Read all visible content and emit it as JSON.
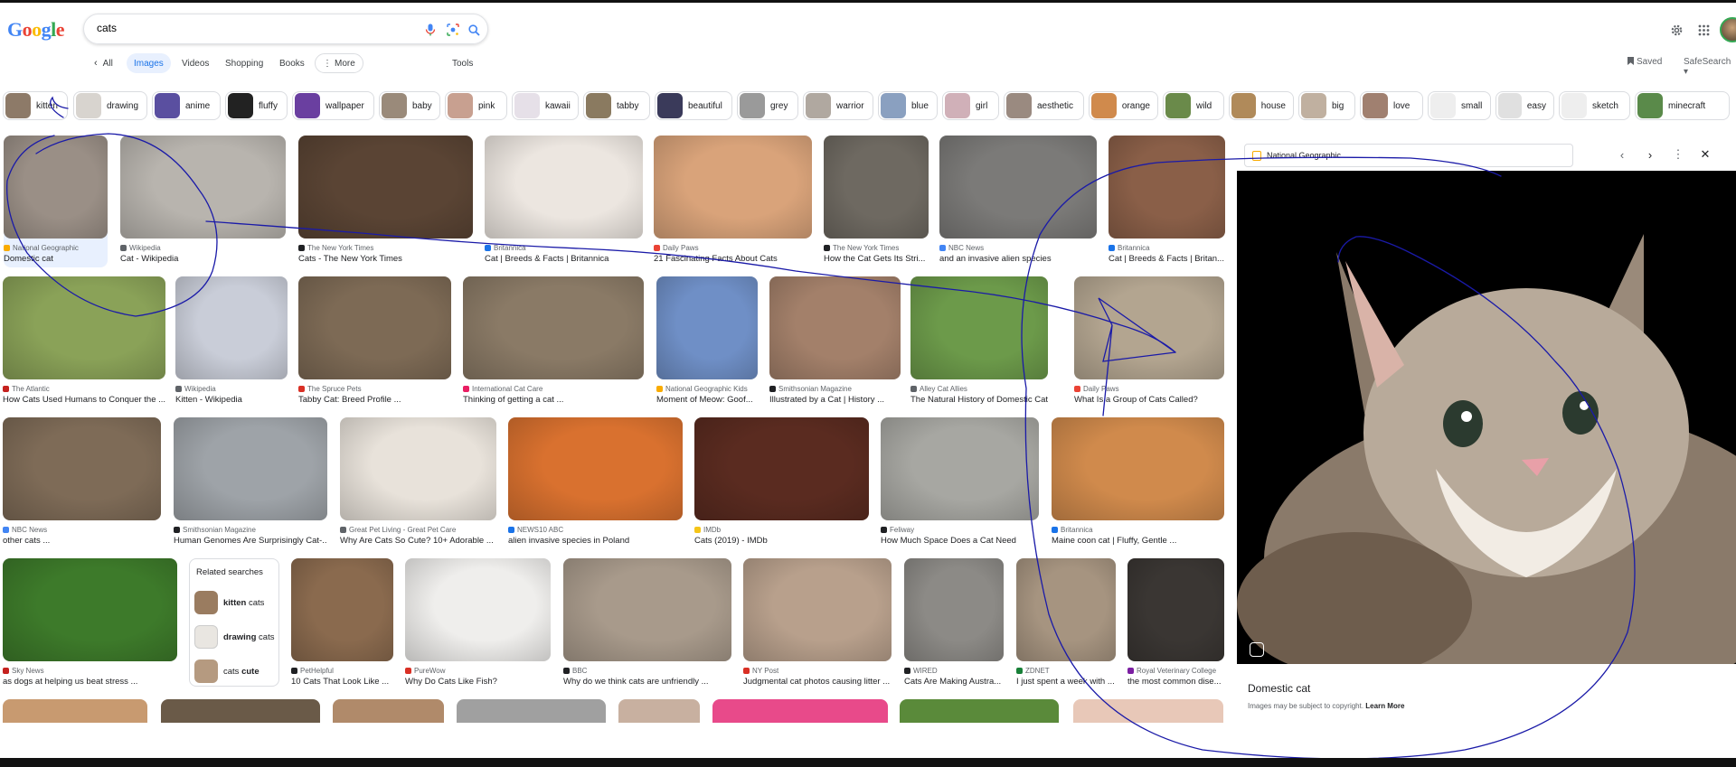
{
  "search": {
    "query": "cats"
  },
  "nav": {
    "all": "All",
    "images": "Images",
    "videos": "Videos",
    "shopping": "Shopping",
    "books": "Books",
    "more": "More",
    "tools": "Tools",
    "saved": "Saved",
    "safesearch": "SafeSearch"
  },
  "chips": [
    "kitten",
    "drawing",
    "anime",
    "fluffy",
    "wallpaper",
    "baby",
    "pink",
    "kawaii",
    "tabby",
    "beautiful",
    "grey",
    "warrior",
    "blue",
    "girl",
    "aesthetic",
    "orange",
    "wild",
    "house",
    "big",
    "love",
    "small",
    "easy",
    "sketch",
    "minecraft"
  ],
  "results": [
    {
      "source": "National Geographic",
      "title": "Domestic cat",
      "color": "#9a8f86",
      "fav": "#f9ab00"
    },
    {
      "source": "Wikipedia",
      "title": "Cat - Wikipedia",
      "color": "#b8b4ae",
      "fav": "#5f6368"
    },
    {
      "source": "The New York Times",
      "title": "Cats - The New York Times",
      "color": "#5a4434",
      "fav": "#202124"
    },
    {
      "source": "Britannica",
      "title": "Cat | Breeds & Facts | Britannica",
      "color": "#ece6e0",
      "fav": "#1a73e8"
    },
    {
      "source": "Daily Paws",
      "title": "21 Fascinating Facts About Cats",
      "color": "#d9a37a",
      "fav": "#ea4335"
    },
    {
      "source": "The New York Times",
      "title": "How the Cat Gets Its Stri...",
      "color": "#6e6961",
      "fav": "#202124"
    },
    {
      "source": "NBC News",
      "title": "and an invasive alien species",
      "color": "#7b7a78",
      "fav": "#4285f4"
    },
    {
      "source": "Britannica",
      "title": "Cat | Breeds & Facts | Britan...",
      "color": "#8a5f48",
      "fav": "#1a73e8"
    },
    {
      "source": "The Atlantic",
      "title": "How Cats Used Humans to Conquer the ...",
      "color": "#8aa258",
      "fav": "#c5221f"
    },
    {
      "source": "Wikipedia",
      "title": "Kitten - Wikipedia",
      "color": "#c9cdd8",
      "fav": "#5f6368"
    },
    {
      "source": "The Spruce Pets",
      "title": "Tabby Cat: Breed Profile ...",
      "color": "#7d6a55",
      "fav": "#d93025"
    },
    {
      "source": "International Cat Care",
      "title": "Thinking of getting a cat ...",
      "color": "#8a7a66",
      "fav": "#e91e63"
    },
    {
      "source": "National Geographic Kids",
      "title": "Moment of Meow: Goof...",
      "color": "#6f8fc6",
      "fav": "#f9ab00"
    },
    {
      "source": "Smithsonian Magazine",
      "title": "Illustrated by a Cat | History ...",
      "color": "#a3806a",
      "fav": "#202124"
    },
    {
      "source": "Alley Cat Allies",
      "title": "The Natural History of Domestic Cats ...",
      "color": "#6c9a4a",
      "fav": "#5f6368"
    },
    {
      "source": "Daily Paws",
      "title": "What Is a Group of Cats Called?",
      "color": "#b3a590",
      "fav": "#ea4335"
    },
    {
      "source": "NBC News",
      "title": "other cats ...",
      "color": "#7e6b57",
      "fav": "#4285f4"
    },
    {
      "source": "Smithsonian Magazine",
      "title": "Human Genomes Are Surprisingly Cat-...",
      "color": "#9ea3a8",
      "fav": "#202124"
    },
    {
      "source": "Great Pet Living - Great Pet Care",
      "title": "Why Are Cats So Cute? 10+ Adorable ...",
      "color": "#e8e2da",
      "fav": "#5f6368"
    },
    {
      "source": "NEWS10 ABC",
      "title": "alien invasive species in Poland",
      "color": "#d9712f",
      "fav": "#1a73e8"
    },
    {
      "source": "IMDb",
      "title": "Cats (2019) - IMDb",
      "color": "#5a2b20",
      "fav": "#f5c518"
    },
    {
      "source": "Feliway",
      "title": "How Much Space Does a Cat Need",
      "color": "#a7a7a2",
      "fav": "#202124"
    },
    {
      "source": "Britannica",
      "title": "Maine coon cat | Fluffy, Gentle ...",
      "color": "#d08a4c",
      "fav": "#1a73e8"
    },
    {
      "source": "Sky News",
      "title": "as dogs at helping us beat stress ...",
      "color": "#3d7a2a",
      "fav": "#c5221f"
    },
    {
      "source": "PetHelpful",
      "title": "10 Cats That Look Like ...",
      "color": "#8a6a4e",
      "fav": "#202124"
    },
    {
      "source": "PureWow",
      "title": "Why Do Cats Like Fish?",
      "color": "#efeeec",
      "fav": "#d93025"
    },
    {
      "source": "BBC",
      "title": "Why do we think cats are unfriendly ...",
      "color": "#a89a8b",
      "fav": "#202124"
    },
    {
      "source": "NY Post",
      "title": "Judgmental cat photos causing litter ...",
      "color": "#b8a08c",
      "fav": "#d93025"
    },
    {
      "source": "WIRED",
      "title": "Cats Are Making Austra...",
      "color": "#8c8a86",
      "fav": "#202124"
    },
    {
      "source": "ZDNET",
      "title": "I just spent a week with ...",
      "color": "#a69480",
      "fav": "#188038"
    },
    {
      "source": "Royal Veterinary College",
      "title": "the most common dise...",
      "color": "#3a3633",
      "fav": "#7b1fa2"
    }
  ],
  "related": {
    "heading": "Related searches",
    "items": [
      {
        "bold": "kitten",
        "rest": " cats"
      },
      {
        "bold": "drawing",
        "rest": " cats"
      },
      {
        "bold": "cute",
        "pre": "cats "
      }
    ]
  },
  "panel": {
    "source": "National Geographic",
    "title": "Domestic cat",
    "copyright": "Images may be subject to copyright.",
    "learn_more": "Learn More"
  },
  "colors": {
    "accent": "#1a73e8",
    "annotation": "#1a1aa8"
  }
}
